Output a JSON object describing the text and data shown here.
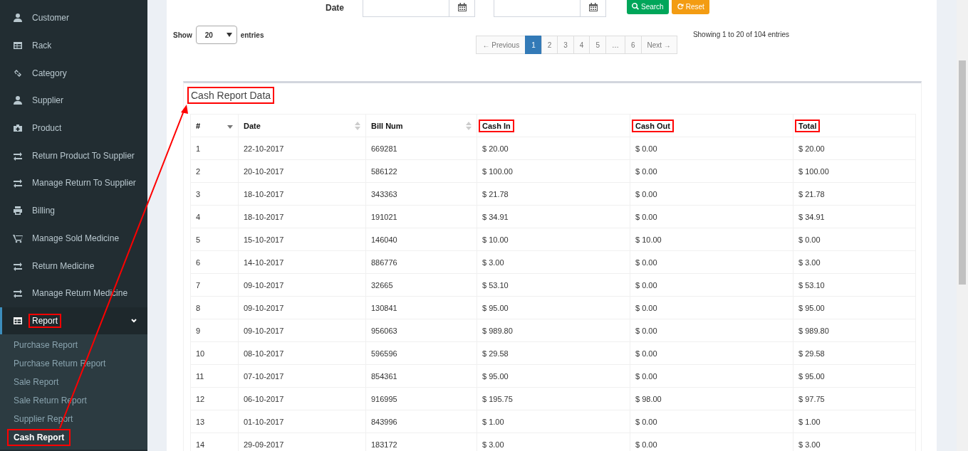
{
  "sidebar": {
    "items": [
      {
        "label": "Customer",
        "highlighted": false,
        "expanded": false
      },
      {
        "label": "Rack",
        "highlighted": false,
        "expanded": false
      },
      {
        "label": "Category",
        "highlighted": false,
        "expanded": false
      },
      {
        "label": "Supplier",
        "highlighted": false,
        "expanded": false
      },
      {
        "label": "Product",
        "highlighted": false,
        "expanded": false
      },
      {
        "label": "Return Product To Supplier",
        "highlighted": false,
        "expanded": false
      },
      {
        "label": "Manage Return To Supplier",
        "highlighted": false,
        "expanded": false
      },
      {
        "label": "Billing",
        "highlighted": false,
        "expanded": false
      },
      {
        "label": "Manage Sold Medicine",
        "highlighted": false,
        "expanded": false
      },
      {
        "label": "Return Medicine",
        "highlighted": false,
        "expanded": false
      },
      {
        "label": "Manage Return Medicine",
        "highlighted": false,
        "expanded": false
      },
      {
        "label": "Report",
        "highlighted": true,
        "expanded": true,
        "children": [
          {
            "label": "Purchase Report",
            "selected": false,
            "highlighted": false
          },
          {
            "label": "Purchase Return Report",
            "selected": false,
            "highlighted": false
          },
          {
            "label": "Sale Report",
            "selected": false,
            "highlighted": false
          },
          {
            "label": "Sale Return Report",
            "selected": false,
            "highlighted": false
          },
          {
            "label": "Supplier Report",
            "selected": false,
            "highlighted": false
          },
          {
            "label": "Cash Report",
            "selected": true,
            "highlighted": true
          }
        ]
      }
    ]
  },
  "filter": {
    "label": "Date",
    "search_button": "Search",
    "reset_button": "Reset"
  },
  "length": {
    "before": "Show",
    "value": "20",
    "after": "entries"
  },
  "pagination": {
    "pages": [
      {
        "label": "← Previous",
        "selected": false
      },
      {
        "label": "1",
        "selected": true
      },
      {
        "label": "2",
        "selected": false
      },
      {
        "label": "3",
        "selected": false
      },
      {
        "label": "4",
        "selected": false
      },
      {
        "label": "5",
        "selected": false
      },
      {
        "label": "…",
        "selected": false
      },
      {
        "label": "6",
        "selected": false
      },
      {
        "label": "Next →",
        "selected": false
      }
    ]
  },
  "info": "Showing 1 to 20 of 104 entries",
  "box": {
    "title": "Cash Report Data",
    "title_highlighted": true
  },
  "table": {
    "columns": [
      {
        "label": "#",
        "kind": "sorted-descending",
        "highlighted": false
      },
      {
        "label": "Date",
        "kind": "sortable",
        "highlighted": false
      },
      {
        "label": "Bill Num",
        "kind": "sortable",
        "highlighted": false
      },
      {
        "label": "Cash In",
        "kind": "plain",
        "highlighted": true
      },
      {
        "label": "Cash Out",
        "kind": "plain",
        "highlighted": true
      },
      {
        "label": "Total",
        "kind": "plain",
        "highlighted": true
      }
    ],
    "rows": [
      [
        "1",
        "22-10-2017",
        "669281",
        "$ 20.00",
        "$ 0.00",
        "$ 20.00"
      ],
      [
        "2",
        "20-10-2017",
        "586122",
        "$ 100.00",
        "$ 0.00",
        "$ 100.00"
      ],
      [
        "3",
        "18-10-2017",
        "343363",
        "$ 21.78",
        "$ 0.00",
        "$ 21.78"
      ],
      [
        "4",
        "18-10-2017",
        "191021",
        "$ 34.91",
        "$ 0.00",
        "$ 34.91"
      ],
      [
        "5",
        "15-10-2017",
        "146040",
        "$ 10.00",
        "$ 10.00",
        "$ 0.00"
      ],
      [
        "6",
        "14-10-2017",
        "886776",
        "$ 3.00",
        "$ 0.00",
        "$ 3.00"
      ],
      [
        "7",
        "09-10-2017",
        "32665",
        "$ 53.10",
        "$ 0.00",
        "$ 53.10"
      ],
      [
        "8",
        "09-10-2017",
        "130841",
        "$ 95.00",
        "$ 0.00",
        "$ 95.00"
      ],
      [
        "9",
        "09-10-2017",
        "956063",
        "$ 989.80",
        "$ 0.00",
        "$ 989.80"
      ],
      [
        "10",
        "08-10-2017",
        "596596",
        "$ 29.58",
        "$ 0.00",
        "$ 29.58"
      ],
      [
        "11",
        "07-10-2017",
        "854361",
        "$ 95.00",
        "$ 0.00",
        "$ 95.00"
      ],
      [
        "12",
        "06-10-2017",
        "916995",
        "$ 195.75",
        "$ 98.00",
        "$ 97.75"
      ],
      [
        "13",
        "01-10-2017",
        "843996",
        "$ 1.00",
        "$ 0.00",
        "$ 1.00"
      ],
      [
        "14",
        "29-09-2017",
        "183172",
        "$ 3.00",
        "$ 0.00",
        "$ 3.00"
      ]
    ]
  }
}
